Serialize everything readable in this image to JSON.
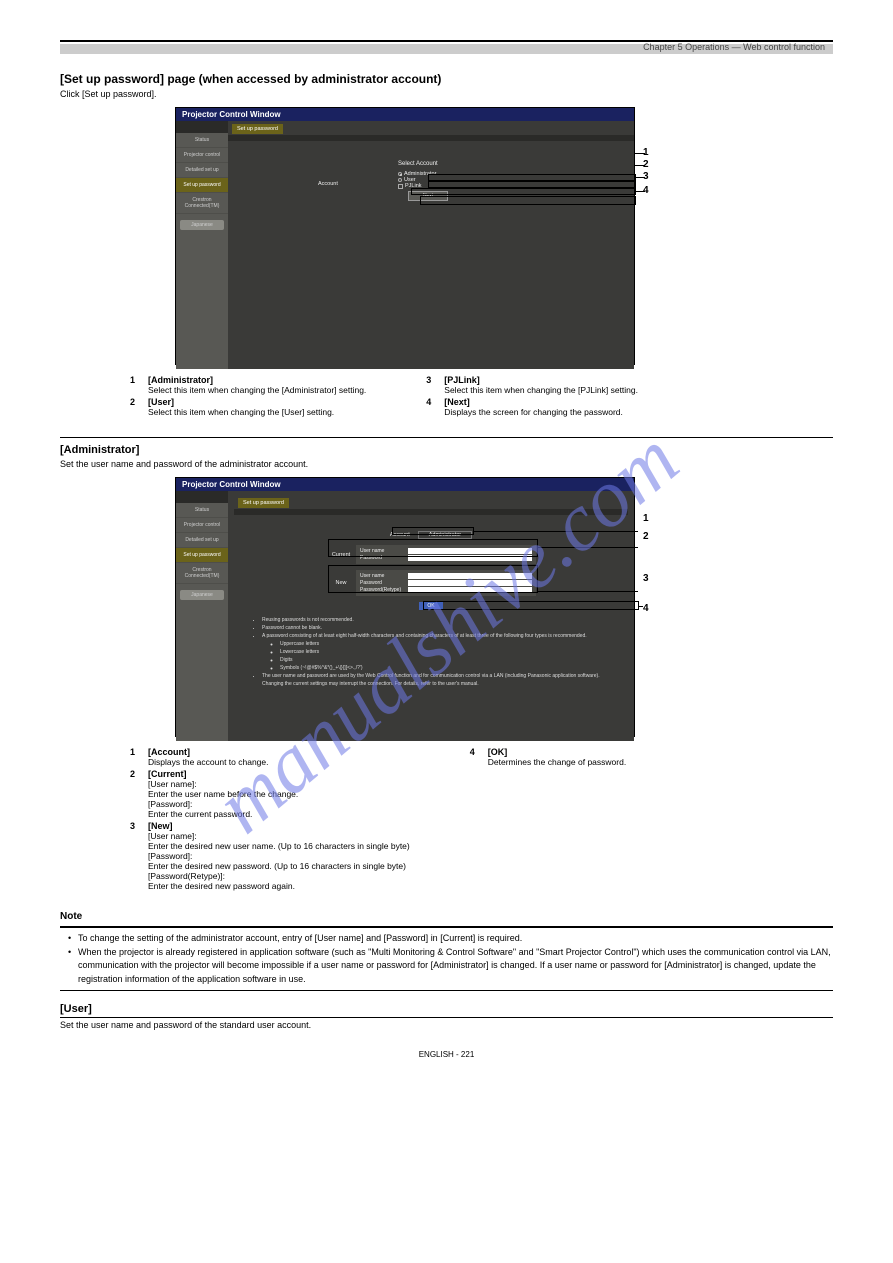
{
  "chapter_header": "Chapter 5 Operations — Web control function",
  "watermark": "manualshive.com",
  "section_title": "[Set up password] page (when accessed by administrator account)",
  "section_body": "Click [Set up password].",
  "screenshot1": {
    "window_title": "Projector Control Window",
    "sidebar": {
      "items": [
        "Status",
        "Projector control",
        "Detailed set up",
        "Set up password",
        "Crestron Connected(TM)"
      ],
      "jp_button": "Japanese"
    },
    "page_button": "Set up password",
    "main_label": "Select Account",
    "account_label": "Account",
    "radios": {
      "admin": "Administrator",
      "user": "User"
    },
    "pjlink": "PJLink",
    "next_btn": "Next"
  },
  "callouts1": {
    "n1": "1",
    "n2": "2",
    "n3": "3",
    "n4": "4",
    "list_left": [
      {
        "n": "1",
        "t": "[Administrator]",
        "s": "Select this item when changing the [Administrator] setting."
      },
      {
        "n": "2",
        "t": "[User]",
        "s": "Select this item when changing the [User] setting."
      }
    ],
    "list_right": [
      {
        "n": "3",
        "t": "[PJLink]",
        "s": "Select this item when changing the [PJLink] setting."
      },
      {
        "n": "4",
        "t": "[Next]",
        "s": "Displays the screen for changing the password."
      }
    ]
  },
  "section2_title": "[Administrator]",
  "section2_body": "Set the user name and password of the administrator account.",
  "screenshot2": {
    "window_title": "Projector Control Window",
    "sidebar": {
      "items": [
        "Status",
        "Projector control",
        "Detailed set up",
        "Set up password",
        "Crestron Connected(TM)"
      ],
      "jp_button": "Japanese"
    },
    "page_button": "Set up password",
    "acct_label": "Account",
    "acct_value": "Administrator",
    "current_label": "Current",
    "new_label": "New",
    "fields": {
      "username": "User name",
      "password": "Password",
      "retype": "Password(Retype)"
    },
    "ok_btn": "OK",
    "notes": [
      "Reusing passwords is not recommended.",
      "Password cannot be blank.",
      "A password consisting of at least eight half-width characters and containing characters of at least three of the following four types is recommended.",
      "Uppercase letters",
      "Lowercase letters",
      "Digits",
      "Symbols (~!@#$%^&*()_+\\|}{][<>.,/?')",
      "The user name and password are used by the Web Control function and for communication control via a LAN (including Panasonic application software).",
      "Changing the current settings may interrupt the connection. For details, refer to the user's manual."
    ]
  },
  "callouts2": {
    "list_left": [
      {
        "n": "1",
        "t": "[Account]",
        "s": "Displays the account to change."
      },
      {
        "n": "2",
        "t": "[Current]",
        "s_lines": [
          "[User name]:",
          "Enter the user name before the change.",
          "[Password]:",
          "Enter the current password."
        ]
      },
      {
        "n": "3",
        "t": "[New]",
        "s_lines": [
          "[User name]:",
          "Enter the desired new user name. (Up to 16 characters in single byte)",
          "[Password]:",
          "Enter the desired new password. (Up to 16 characters in single byte)",
          "[Password(Retype)]:",
          "Enter the desired new password again."
        ]
      }
    ],
    "list_right": [
      {
        "n": "4",
        "t": "[OK]",
        "s": "Determines the change of password."
      }
    ]
  },
  "note_title": "Note",
  "notes": [
    "To change the setting of the administrator account, entry of [User name] and [Password] in [Current] is required.",
    "When the projector is already registered in application software (such as \"Multi Monitoring & Control Software\" and \"Smart Projector Control\") which uses the communication control via LAN, communication with the projector will become impossible if a user name or password for [Administrator] is changed. If a user name or password for [Administrator] is changed, update the registration information of the application software in use."
  ],
  "user_subhead": "[User]",
  "user_body": "Set the user name and password of the standard user account.",
  "page_num": "ENGLISH - 221"
}
